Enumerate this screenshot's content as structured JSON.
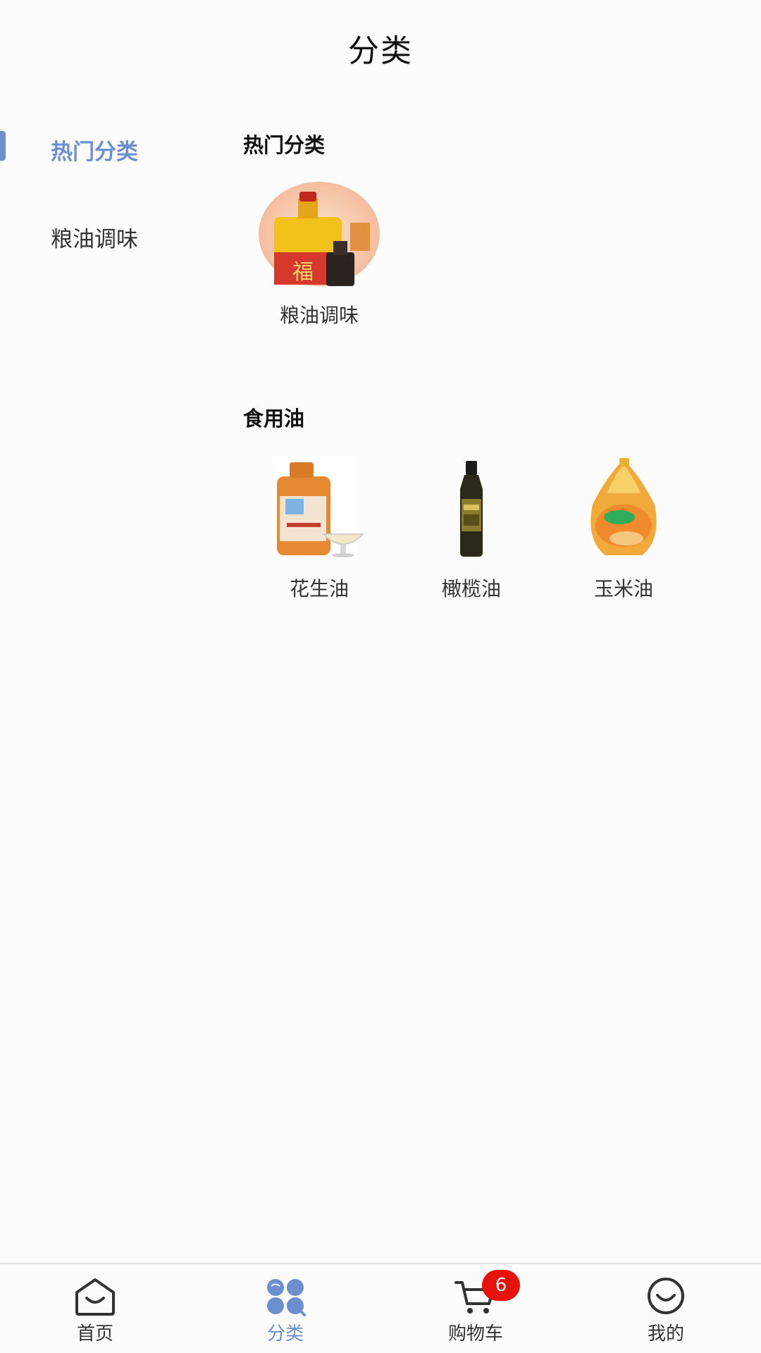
{
  "header": {
    "title": "分类"
  },
  "sidebar": {
    "items": [
      {
        "label": "热门分类",
        "active": true
      },
      {
        "label": "粮油调味",
        "active": false
      }
    ],
    "accent_color": "#6b8fd0"
  },
  "sections": [
    {
      "title": "热门分类",
      "items": [
        {
          "label": "粮油调味",
          "image": "oil-and-soy-sauce-product-image"
        }
      ]
    },
    {
      "title": "食用油",
      "items": [
        {
          "label": "花生油",
          "image": "peanut-oil-jug-image"
        },
        {
          "label": "橄榄油",
          "image": "olive-oil-bottle-image"
        },
        {
          "label": "玉米油",
          "image": "corn-oil-jug-image"
        }
      ]
    }
  ],
  "tabbar": {
    "tabs": [
      {
        "label": "首页",
        "icon": "home-icon"
      },
      {
        "label": "分类",
        "icon": "category-icon",
        "active": true
      },
      {
        "label": "购物车",
        "icon": "cart-icon",
        "badge": "6"
      },
      {
        "label": "我的",
        "icon": "profile-icon"
      }
    ],
    "badge_color": "#e8120c"
  }
}
